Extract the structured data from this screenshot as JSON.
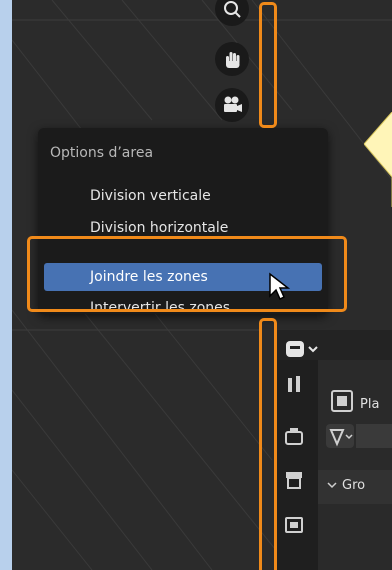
{
  "menu": {
    "title": "Options d’area",
    "items": [
      {
        "label": "Division verticale"
      },
      {
        "label": "Division horizontale"
      },
      {
        "label": "Joindre les zones",
        "active": true
      },
      {
        "label": "Intervertir les zones"
      }
    ]
  },
  "properties": {
    "plane_label": "Pla",
    "group_label": "Gro"
  },
  "colors": {
    "highlight": "#f08a1a",
    "menu_active": "#4772b3",
    "tooltip": "#fff5b8"
  }
}
